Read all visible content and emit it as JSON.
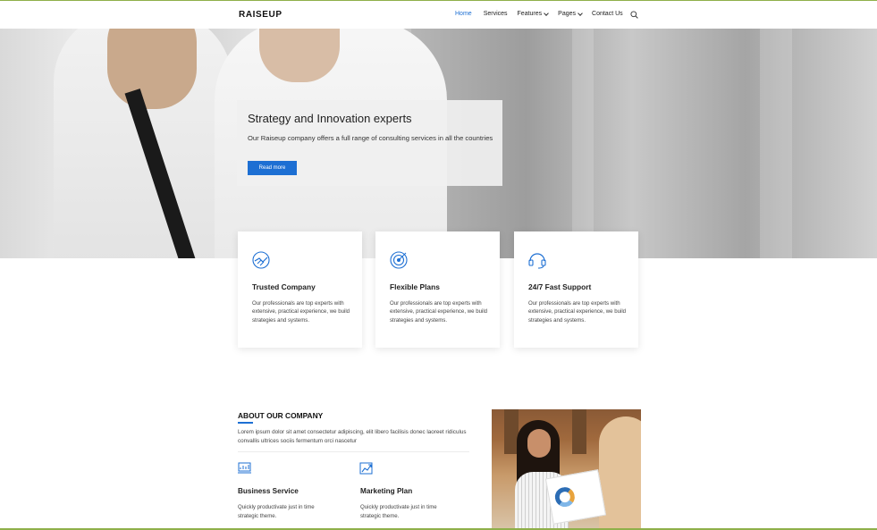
{
  "header": {
    "logo": "RAISEUP",
    "nav": [
      {
        "label": "Home",
        "active": true,
        "dropdown": false
      },
      {
        "label": "Services",
        "active": false,
        "dropdown": false
      },
      {
        "label": "Features",
        "active": false,
        "dropdown": true
      },
      {
        "label": "Pages",
        "active": false,
        "dropdown": true
      },
      {
        "label": "Contact Us",
        "active": false,
        "dropdown": false
      }
    ],
    "search_icon": "search-icon"
  },
  "hero": {
    "title": "Strategy and Innovation experts",
    "description": "Our Raiseup company offers a full range of consulting services in all the countries",
    "button_label": "Read more"
  },
  "features": [
    {
      "icon": "handshake-icon",
      "title": "Trusted Company",
      "text": "Our professionals are top experts with extensive, practical experience, we build strategies and systems."
    },
    {
      "icon": "target-icon",
      "title": "Flexible Plans",
      "text": "Our professionals are top experts with extensive, practical experience, we build strategies and systems."
    },
    {
      "icon": "headset-icon",
      "title": "24/7 Fast Support",
      "text": "Our professionals are top experts with extensive, practical experience, we build strategies and systems."
    }
  ],
  "about": {
    "title": "ABOUT OUR COMPANY",
    "description": "Lorem ipsum dolor sit amet consectetur adipiscing, elit libero facilisis donec laoreet ridiculus convallis ultrices sociis fermentum orci nascetur",
    "services": [
      {
        "icon": "chart-board-icon",
        "title": "Business Service",
        "text": "Quickly productivate just in time strategic theme."
      },
      {
        "icon": "growth-chart-icon",
        "title": "Marketing Plan",
        "text": "Quickly productivate just in time strategic theme."
      }
    ]
  },
  "colors": {
    "accent": "#1d6fd3",
    "frame_border": "#8fb04a"
  }
}
